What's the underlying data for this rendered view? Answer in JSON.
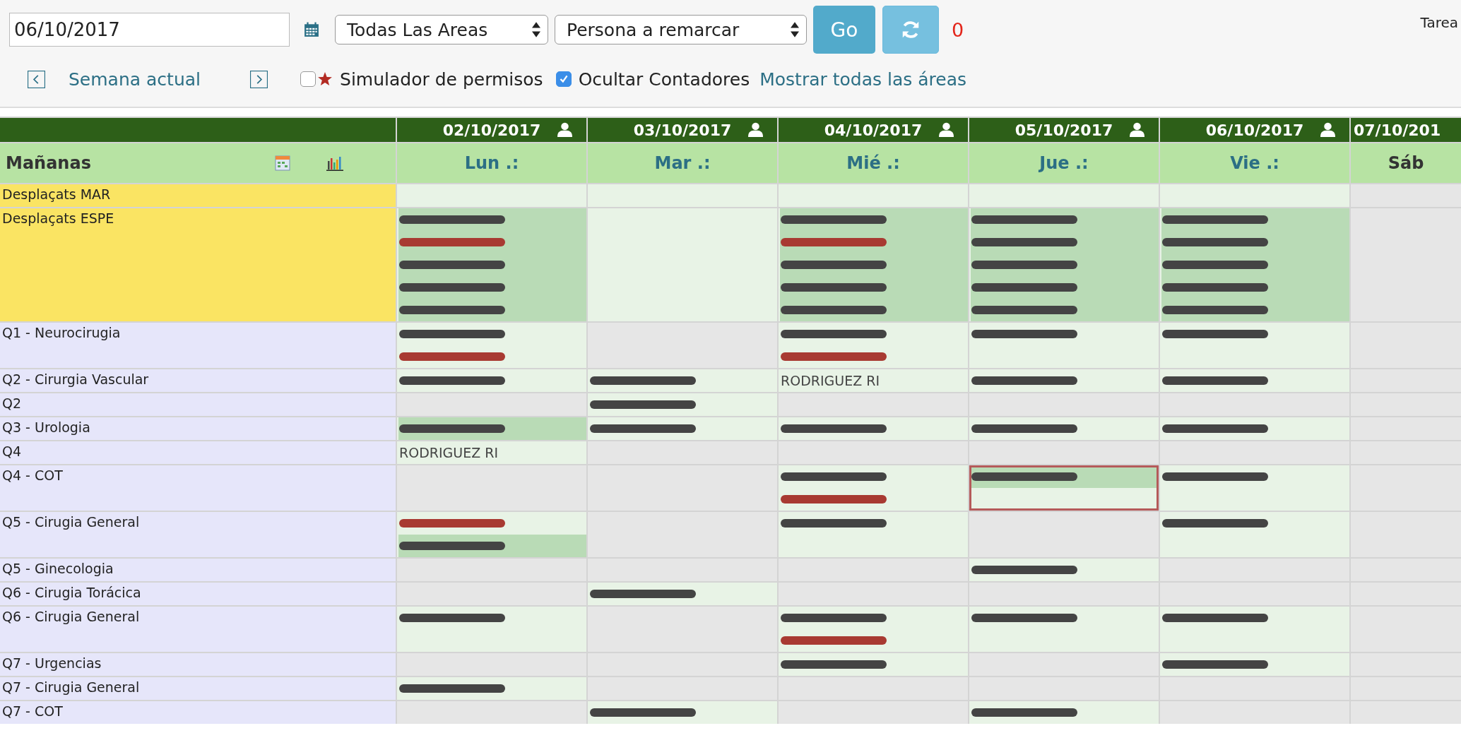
{
  "toolbar": {
    "date_field": {
      "value": "06/10/2017"
    },
    "area_select": {
      "value": "Todas Las Areas"
    },
    "person_select": {
      "value": "Persona a remarcar"
    },
    "go_button": "Go",
    "counter": "0",
    "right_label": "Tarea"
  },
  "week_nav": {
    "current_week": "Semana actual",
    "permissions_simulator": {
      "label": "Simulador de permisos",
      "checked": false
    },
    "hide_counters": {
      "label": "Ocultar Contadores",
      "checked": true
    },
    "show_all_link": "Mostrar todas las áreas"
  },
  "schedule": {
    "shift_title": "Mañanas",
    "days": [
      {
        "date": "02/10/2017",
        "weekday": "Lun .:",
        "weekend": false,
        "person_icon": true
      },
      {
        "date": "03/10/2017",
        "weekday": "Mar .:",
        "weekend": false,
        "person_icon": true
      },
      {
        "date": "04/10/2017",
        "weekday": "Mié .:",
        "weekend": false,
        "person_icon": true
      },
      {
        "date": "05/10/2017",
        "weekday": "Jue .:",
        "weekend": false,
        "person_icon": true
      },
      {
        "date": "06/10/2017",
        "weekday": "Vie .:",
        "weekend": false,
        "person_icon": true
      },
      {
        "date": "07/10/201",
        "weekday": "Sáb",
        "weekend": true,
        "person_icon": false
      }
    ],
    "rows": [
      {
        "area": "Desplaçats MAR",
        "color": "#fae463",
        "cells": [
          {
            "kind": "open",
            "selected": false
          },
          {
            "kind": "open",
            "selected": false
          },
          {
            "kind": "open",
            "selected": false
          },
          {
            "kind": "open",
            "selected": false
          },
          {
            "kind": "open",
            "selected": false
          },
          {
            "kind": "empty",
            "selected": false
          }
        ]
      },
      {
        "area": "Desplaçats ESPE",
        "color": "#fae463",
        "cells": [
          {
            "kind": "open",
            "selected": false,
            "entries": [
              {
                "kind": "blurred",
                "color": "#444444",
                "highlighted": true
              },
              {
                "kind": "blurred",
                "color": "#a83a32",
                "highlighted": true
              },
              {
                "kind": "blurred",
                "color": "#444444",
                "highlighted": true
              },
              {
                "kind": "blurred",
                "color": "#444444",
                "highlighted": true
              },
              {
                "kind": "blurred",
                "color": "#444444",
                "highlighted": true
              }
            ]
          },
          {
            "kind": "open",
            "selected": false
          },
          {
            "kind": "open",
            "selected": false,
            "entries": [
              {
                "kind": "blurred",
                "color": "#444444",
                "highlighted": true
              },
              {
                "kind": "blurred",
                "color": "#a83a32",
                "highlighted": true
              },
              {
                "kind": "blurred",
                "color": "#444444",
                "highlighted": true
              },
              {
                "kind": "blurred",
                "color": "#444444",
                "highlighted": true
              },
              {
                "kind": "blurred",
                "color": "#444444",
                "highlighted": true
              }
            ]
          },
          {
            "kind": "open",
            "selected": false,
            "entries": [
              {
                "kind": "blurred",
                "color": "#444444",
                "highlighted": true
              },
              {
                "kind": "blurred",
                "color": "#444444",
                "highlighted": true
              },
              {
                "kind": "blurred",
                "color": "#444444",
                "highlighted": true
              },
              {
                "kind": "blurred",
                "color": "#444444",
                "highlighted": true
              },
              {
                "kind": "blurred",
                "color": "#444444",
                "highlighted": true
              }
            ]
          },
          {
            "kind": "open",
            "selected": false,
            "entries": [
              {
                "kind": "blurred",
                "color": "#444444",
                "highlighted": true
              },
              {
                "kind": "blurred",
                "color": "#444444",
                "highlighted": true
              },
              {
                "kind": "blurred",
                "color": "#444444",
                "highlighted": true
              },
              {
                "kind": "blurred",
                "color": "#444444",
                "highlighted": true
              },
              {
                "kind": "blurred",
                "color": "#444444",
                "highlighted": true
              }
            ]
          },
          {
            "kind": "empty",
            "selected": false
          }
        ]
      },
      {
        "area": "Q1 - Neurocirugia",
        "color": "#e6e6fa",
        "cells": [
          {
            "kind": "open",
            "selected": false,
            "entries": [
              {
                "kind": "blurred",
                "color": "#444444",
                "highlighted": false
              },
              {
                "kind": "blurred",
                "color": "#a83a32",
                "highlighted": false
              }
            ]
          },
          {
            "kind": "empty",
            "selected": false
          },
          {
            "kind": "open",
            "selected": false,
            "entries": [
              {
                "kind": "blurred",
                "color": "#444444",
                "highlighted": false
              },
              {
                "kind": "blurred",
                "color": "#a83a32",
                "highlighted": false
              }
            ]
          },
          {
            "kind": "open",
            "selected": false,
            "entries": [
              {
                "kind": "blurred",
                "color": "#444444",
                "highlighted": false
              }
            ]
          },
          {
            "kind": "open",
            "selected": false,
            "entries": [
              {
                "kind": "blurred",
                "color": "#444444",
                "highlighted": false
              }
            ]
          },
          {
            "kind": "empty",
            "selected": false
          }
        ]
      },
      {
        "area": "Q2 - Cirurgia Vascular",
        "color": "#e6e6fa",
        "cells": [
          {
            "kind": "open",
            "selected": false,
            "entries": [
              {
                "kind": "blurred",
                "color": "#444444",
                "highlighted": false
              }
            ]
          },
          {
            "kind": "open",
            "selected": false,
            "entries": [
              {
                "kind": "blurred",
                "color": "#444444",
                "highlighted": false
              }
            ]
          },
          {
            "kind": "open",
            "selected": false,
            "entries": [
              {
                "kind": "name",
                "text": "RODRIGUEZ RI",
                "color": "#444444",
                "highlighted": false
              }
            ]
          },
          {
            "kind": "open",
            "selected": false,
            "entries": [
              {
                "kind": "blurred",
                "color": "#444444",
                "highlighted": false
              }
            ]
          },
          {
            "kind": "open",
            "selected": false,
            "entries": [
              {
                "kind": "blurred",
                "color": "#444444",
                "highlighted": false
              }
            ]
          },
          {
            "kind": "empty",
            "selected": false
          }
        ]
      },
      {
        "area": "Q2",
        "color": "#e6e6fa",
        "cells": [
          {
            "kind": "empty",
            "selected": false
          },
          {
            "kind": "open",
            "selected": false,
            "entries": [
              {
                "kind": "blurred",
                "color": "#444444",
                "highlighted": false
              }
            ]
          },
          {
            "kind": "empty",
            "selected": false
          },
          {
            "kind": "empty",
            "selected": false
          },
          {
            "kind": "empty",
            "selected": false
          },
          {
            "kind": "empty",
            "selected": false
          }
        ]
      },
      {
        "area": "Q3 - Urologia",
        "color": "#e6e6fa",
        "cells": [
          {
            "kind": "open",
            "selected": false,
            "entries": [
              {
                "kind": "blurred",
                "color": "#444444",
                "highlighted": true
              }
            ]
          },
          {
            "kind": "open",
            "selected": false,
            "entries": [
              {
                "kind": "blurred",
                "color": "#444444",
                "highlighted": false
              }
            ]
          },
          {
            "kind": "open",
            "selected": false,
            "entries": [
              {
                "kind": "blurred",
                "color": "#444444",
                "highlighted": false
              }
            ]
          },
          {
            "kind": "open",
            "selected": false,
            "entries": [
              {
                "kind": "blurred",
                "color": "#444444",
                "highlighted": false
              }
            ]
          },
          {
            "kind": "open",
            "selected": false,
            "entries": [
              {
                "kind": "blurred",
                "color": "#444444",
                "highlighted": false
              }
            ]
          },
          {
            "kind": "empty",
            "selected": false
          }
        ]
      },
      {
        "area": "Q4",
        "color": "#e6e6fa",
        "cells": [
          {
            "kind": "open",
            "selected": false,
            "entries": [
              {
                "kind": "name",
                "text": "RODRIGUEZ RI",
                "color": "#444444",
                "highlighted": false
              }
            ]
          },
          {
            "kind": "empty",
            "selected": false
          },
          {
            "kind": "empty",
            "selected": false
          },
          {
            "kind": "empty",
            "selected": false
          },
          {
            "kind": "empty",
            "selected": false
          },
          {
            "kind": "empty",
            "selected": false
          }
        ]
      },
      {
        "area": "Q4 - COT",
        "color": "#e6e6fa",
        "cells": [
          {
            "kind": "empty",
            "selected": false
          },
          {
            "kind": "empty",
            "selected": false
          },
          {
            "kind": "open",
            "selected": false,
            "entries": [
              {
                "kind": "blurred",
                "color": "#444444",
                "highlighted": false
              },
              {
                "kind": "blurred",
                "color": "#a83a32",
                "highlighted": false
              }
            ]
          },
          {
            "kind": "open",
            "selected": true,
            "entries": [
              {
                "kind": "blurred",
                "color": "#444444",
                "highlighted": true
              }
            ]
          },
          {
            "kind": "open",
            "selected": false,
            "entries": [
              {
                "kind": "blurred",
                "color": "#444444",
                "highlighted": false
              }
            ]
          },
          {
            "kind": "empty",
            "selected": false
          }
        ]
      },
      {
        "area": "Q5 - Cirugia General",
        "color": "#e6e6fa",
        "cells": [
          {
            "kind": "open",
            "selected": false,
            "entries": [
              {
                "kind": "blurred",
                "color": "#a83a32",
                "highlighted": false
              },
              {
                "kind": "blurred",
                "color": "#444444",
                "highlighted": true
              }
            ]
          },
          {
            "kind": "empty",
            "selected": false
          },
          {
            "kind": "open",
            "selected": false,
            "entries": [
              {
                "kind": "blurred",
                "color": "#444444",
                "highlighted": false
              }
            ]
          },
          {
            "kind": "empty",
            "selected": false
          },
          {
            "kind": "open",
            "selected": false,
            "entries": [
              {
                "kind": "blurred",
                "color": "#444444",
                "highlighted": false
              }
            ]
          },
          {
            "kind": "empty",
            "selected": false
          }
        ]
      },
      {
        "area": "Q5 - Ginecologia",
        "color": "#e6e6fa",
        "cells": [
          {
            "kind": "empty",
            "selected": false
          },
          {
            "kind": "empty",
            "selected": false
          },
          {
            "kind": "empty",
            "selected": false
          },
          {
            "kind": "open",
            "selected": false,
            "entries": [
              {
                "kind": "blurred",
                "color": "#444444",
                "highlighted": false
              }
            ]
          },
          {
            "kind": "empty",
            "selected": false
          },
          {
            "kind": "empty",
            "selected": false
          }
        ]
      },
      {
        "area": "Q6 - Cirugia Torácica",
        "color": "#e6e6fa",
        "cells": [
          {
            "kind": "empty",
            "selected": false
          },
          {
            "kind": "open",
            "selected": false,
            "entries": [
              {
                "kind": "blurred",
                "color": "#444444",
                "highlighted": false
              }
            ]
          },
          {
            "kind": "empty",
            "selected": false
          },
          {
            "kind": "empty",
            "selected": false
          },
          {
            "kind": "empty",
            "selected": false
          },
          {
            "kind": "empty",
            "selected": false
          }
        ]
      },
      {
        "area": "Q6 - Cirugia General",
        "color": "#e6e6fa",
        "cells": [
          {
            "kind": "open",
            "selected": false,
            "entries": [
              {
                "kind": "blurred",
                "color": "#444444",
                "highlighted": false
              }
            ]
          },
          {
            "kind": "empty",
            "selected": false
          },
          {
            "kind": "open",
            "selected": false,
            "entries": [
              {
                "kind": "blurred",
                "color": "#444444",
                "highlighted": false
              },
              {
                "kind": "blurred",
                "color": "#a83a32",
                "highlighted": false
              }
            ]
          },
          {
            "kind": "open",
            "selected": false,
            "entries": [
              {
                "kind": "blurred",
                "color": "#444444",
                "highlighted": false
              }
            ]
          },
          {
            "kind": "open",
            "selected": false,
            "entries": [
              {
                "kind": "blurred",
                "color": "#444444",
                "highlighted": false
              }
            ]
          },
          {
            "kind": "empty",
            "selected": false
          }
        ]
      },
      {
        "area": "Q7 - Urgencias",
        "color": "#e6e6fa",
        "cells": [
          {
            "kind": "empty",
            "selected": false
          },
          {
            "kind": "empty",
            "selected": false
          },
          {
            "kind": "open",
            "selected": false,
            "entries": [
              {
                "kind": "blurred",
                "color": "#444444",
                "highlighted": false
              }
            ]
          },
          {
            "kind": "empty",
            "selected": false
          },
          {
            "kind": "open",
            "selected": false,
            "entries": [
              {
                "kind": "blurred",
                "color": "#444444",
                "highlighted": false
              }
            ]
          },
          {
            "kind": "empty",
            "selected": false
          }
        ]
      },
      {
        "area": "Q7 - Cirugia General",
        "color": "#e6e6fa",
        "cells": [
          {
            "kind": "open",
            "selected": false,
            "entries": [
              {
                "kind": "blurred",
                "color": "#444444",
                "highlighted": false
              }
            ]
          },
          {
            "kind": "empty",
            "selected": false
          },
          {
            "kind": "empty",
            "selected": false
          },
          {
            "kind": "empty",
            "selected": false
          },
          {
            "kind": "empty",
            "selected": false
          },
          {
            "kind": "empty",
            "selected": false
          }
        ]
      },
      {
        "area": "Q7 - COT",
        "color": "#e6e6fa",
        "cells": [
          {
            "kind": "empty",
            "selected": false
          },
          {
            "kind": "open",
            "selected": false,
            "entries": [
              {
                "kind": "blurred",
                "color": "#444444",
                "highlighted": false
              }
            ]
          },
          {
            "kind": "empty",
            "selected": false
          },
          {
            "kind": "open",
            "selected": false,
            "entries": [
              {
                "kind": "blurred",
                "color": "#444444",
                "highlighted": false
              }
            ]
          },
          {
            "kind": "empty",
            "selected": false
          },
          {
            "kind": "empty",
            "selected": false
          }
        ]
      }
    ]
  }
}
